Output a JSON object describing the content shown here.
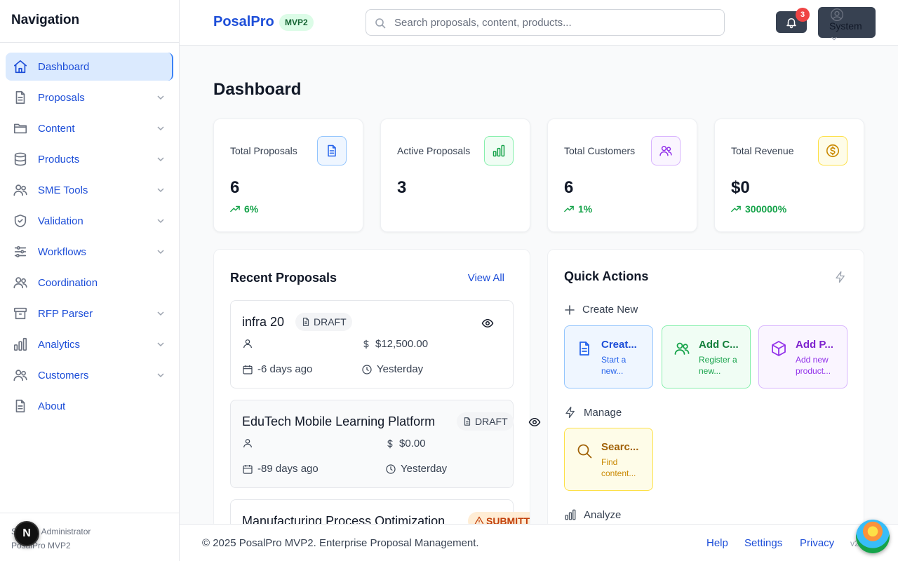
{
  "sidebar": {
    "title": "Navigation",
    "items": [
      {
        "label": "Dashboard",
        "icon": "home-icon",
        "active": true,
        "expandable": false
      },
      {
        "label": "Proposals",
        "icon": "file-icon",
        "expandable": true
      },
      {
        "label": "Content",
        "icon": "folder-icon",
        "expandable": true
      },
      {
        "label": "Products",
        "icon": "database-icon",
        "expandable": true
      },
      {
        "label": "SME Tools",
        "icon": "users-icon",
        "expandable": true
      },
      {
        "label": "Validation",
        "icon": "shield-check-icon",
        "expandable": true
      },
      {
        "label": "Workflows",
        "icon": "sliders-icon",
        "expandable": true
      },
      {
        "label": "Coordination",
        "icon": "users-icon",
        "expandable": false
      },
      {
        "label": "RFP Parser",
        "icon": "archive-icon",
        "expandable": true
      },
      {
        "label": "Analytics",
        "icon": "bar-chart-icon",
        "expandable": true
      },
      {
        "label": "Customers",
        "icon": "users-icon",
        "expandable": true
      },
      {
        "label": "About",
        "icon": "file-icon",
        "expandable": false
      }
    ],
    "footer": {
      "user": "System Administrator",
      "product": "PosalPro MVP2"
    }
  },
  "header": {
    "brand": "PosalPro",
    "badge": "MVP2",
    "search_placeholder": "Search proposals, content, products...",
    "notifications_count": "3",
    "user_button": "System"
  },
  "page": {
    "title": "Dashboard"
  },
  "stats": [
    {
      "label": "Total Proposals",
      "value": "6",
      "trend": "6%",
      "icon": "file-text-icon"
    },
    {
      "label": "Active Proposals",
      "value": "3",
      "trend": "",
      "icon": "bar-chart-icon"
    },
    {
      "label": "Total Customers",
      "value": "6",
      "trend": "1%",
      "icon": "users-icon"
    },
    {
      "label": "Total Revenue",
      "value": "$0",
      "trend": "300000%",
      "icon": "dollar-circle-icon"
    }
  ],
  "recent": {
    "title": "Recent Proposals",
    "view_all": "View All",
    "items": [
      {
        "name": "infra 20",
        "status": "DRAFT",
        "amount": "$12,500.00",
        "created": "-6 days ago",
        "due": "Yesterday"
      },
      {
        "name": "EduTech Mobile Learning Platform",
        "status": "DRAFT",
        "amount": "$0.00",
        "created": "-89 days ago",
        "due": "Yesterday"
      },
      {
        "name": "Manufacturing Process Optimization",
        "status": "SUBMITTED"
      }
    ]
  },
  "quick_actions": {
    "title": "Quick Actions",
    "create_section": "Create New",
    "manage_section": "Manage",
    "analyze_section": "Analyze",
    "create": [
      {
        "name": "Creat...",
        "desc": "Start a new...",
        "icon": "file-text-icon"
      },
      {
        "name": "Add C...",
        "desc": "Register a new...",
        "icon": "users-icon"
      },
      {
        "name": "Add P...",
        "desc": "Add new product...",
        "icon": "box-icon"
      }
    ],
    "manage": [
      {
        "name": "Searc...",
        "desc": "Find content...",
        "icon": "search-icon"
      }
    ]
  },
  "footer": {
    "copyright": "© 2025 PosalPro MVP2. Enterprise Proposal Management.",
    "links": [
      "Help",
      "Settings",
      "Privacy"
    ],
    "version": "v2"
  },
  "floating": {
    "dev_badge": "N"
  },
  "colors": {
    "accent": "#1d4ed8",
    "active_bg": "#dbeafe",
    "trend_green": "#16a34a",
    "badge_green_bg": "#dcfce7",
    "notification_red": "#ef4444"
  }
}
